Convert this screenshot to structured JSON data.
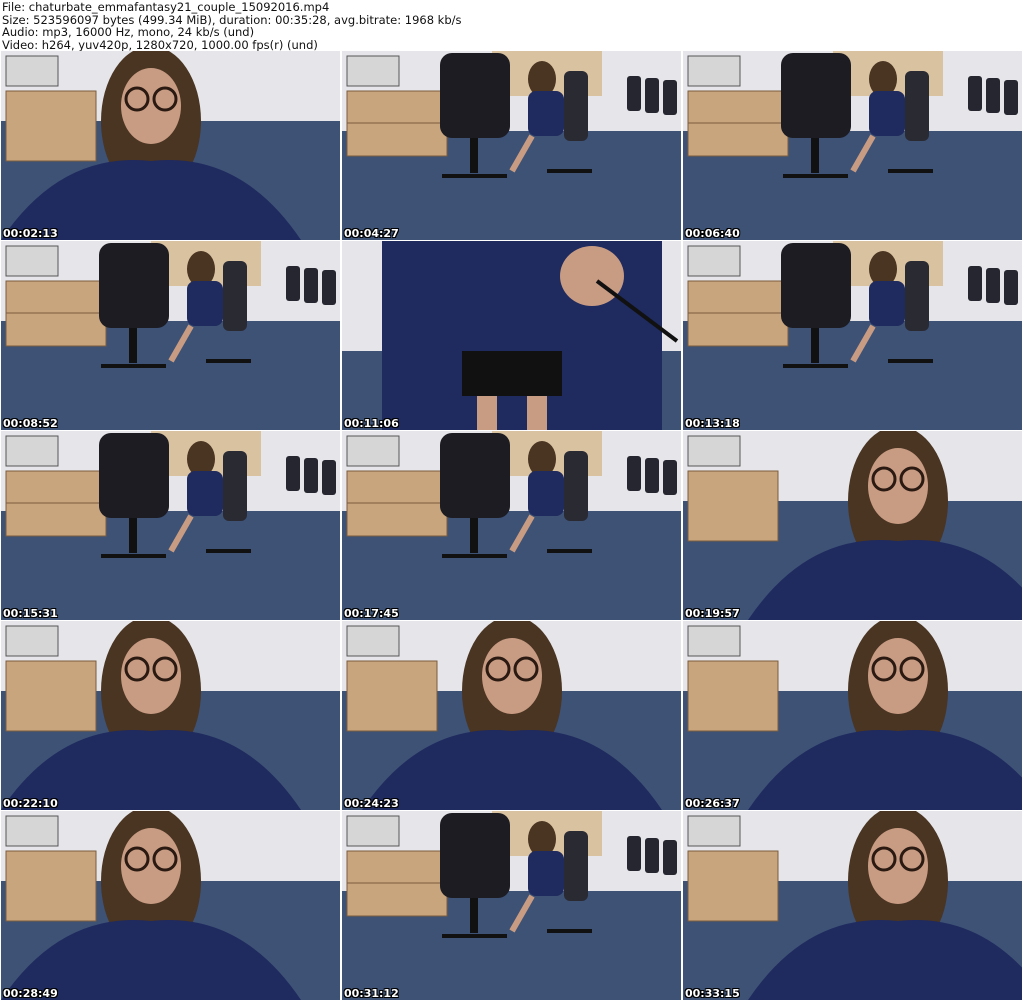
{
  "header": {
    "file": "File: chaturbate_emmafantasy21_couple_15092016.mp4",
    "size": "Size: 523596097 bytes (499.34 MiB), duration: 00:35:28, avg.bitrate: 1968 kb/s",
    "audio": "Audio: mp3, 16000 Hz, mono, 24 kb/s (und)",
    "video": "Video: h264, yuv420p, 1280x720, 1000.00 fps(r) (und)"
  },
  "frames": [
    {
      "time": "00:02:13",
      "scene": "closeup-left"
    },
    {
      "time": "00:04:27",
      "scene": "office-far"
    },
    {
      "time": "00:06:40",
      "scene": "office-far"
    },
    {
      "time": "00:08:52",
      "scene": "office-far"
    },
    {
      "time": "00:11:06",
      "scene": "standing-closeup"
    },
    {
      "time": "00:13:18",
      "scene": "office-far"
    },
    {
      "time": "00:15:31",
      "scene": "office-far"
    },
    {
      "time": "00:17:45",
      "scene": "office-far"
    },
    {
      "time": "00:19:57",
      "scene": "closeup-right"
    },
    {
      "time": "00:22:10",
      "scene": "closeup-left"
    },
    {
      "time": "00:24:23",
      "scene": "closeup-center"
    },
    {
      "time": "00:26:37",
      "scene": "closeup-right"
    },
    {
      "time": "00:28:49",
      "scene": "closeup-left"
    },
    {
      "time": "00:31:12",
      "scene": "office-far"
    },
    {
      "time": "00:33:15",
      "scene": "closeup-right"
    }
  ],
  "colors": {
    "wall": "#e6e6ea",
    "floor": "#3d5275",
    "desk": "#c9a57e",
    "chair": "#1c1c22",
    "blouse": "#1f2a5e",
    "hair": "#4a3422",
    "skin": "#c89b83"
  }
}
